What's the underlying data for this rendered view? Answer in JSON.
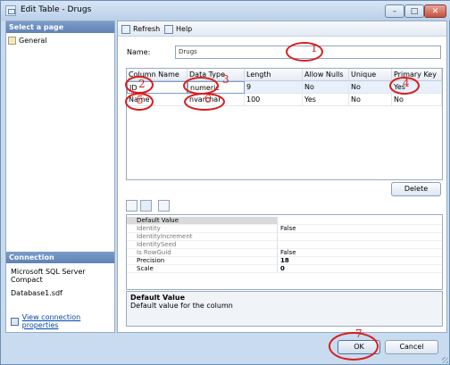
{
  "window": {
    "title": "Edit Table - Drugs",
    "min_glyph": "–",
    "max_glyph": "□",
    "close_glyph": "✕"
  },
  "left_pane": {
    "select_page_header": "Select a page",
    "pages": [
      {
        "label": "General",
        "icon": "page-icon"
      }
    ],
    "connection_header": "Connection",
    "server": "Microsoft SQL Server Compact",
    "database": "Database1.sdf",
    "connection_link": "View connection properties"
  },
  "toolbar": {
    "refresh_label": "Refresh",
    "help_label": "Help"
  },
  "name_field": {
    "label": "Name:",
    "value": "Drugs"
  },
  "columns_grid": {
    "headers": [
      "Column Name",
      "Data Type",
      "Length",
      "Allow Nulls",
      "Unique",
      "Primary Key"
    ],
    "rows": [
      [
        "ID",
        "numeric",
        "9",
        "No",
        "No",
        "Yes"
      ],
      [
        "Name",
        "nvarchar",
        "100",
        "Yes",
        "No",
        "No"
      ]
    ]
  },
  "delete_button": "Delete",
  "properties": {
    "rows": [
      {
        "name": "Default Value",
        "value": ""
      },
      {
        "name": "Identity",
        "value": "False"
      },
      {
        "name": "IdentityIncrement",
        "value": ""
      },
      {
        "name": "IdentitySeed",
        "value": ""
      },
      {
        "name": "Is RowGuid",
        "value": "False"
      },
      {
        "name": "Precision",
        "value": "18"
      },
      {
        "name": "Scale",
        "value": "0"
      }
    ],
    "description_title": "Default Value",
    "description_text": "Default value for the column"
  },
  "buttons": {
    "ok": "OK",
    "cancel": "Cancel"
  },
  "annotations": {
    "color": "#d81e1e",
    "numbers": [
      "1",
      "2",
      "3",
      "4",
      "5",
      "6",
      "7"
    ]
  }
}
